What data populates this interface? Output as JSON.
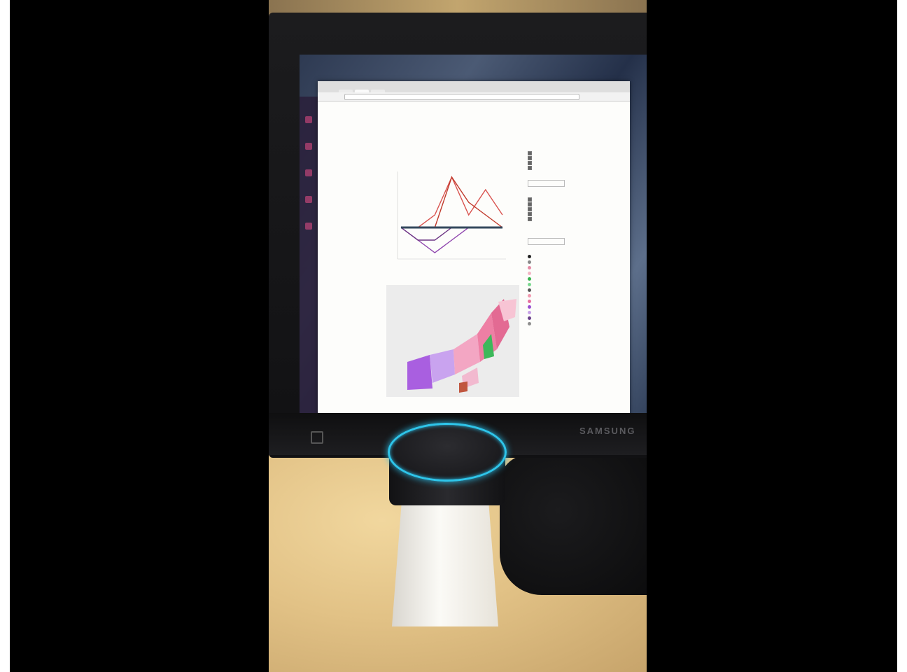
{
  "monitor": {
    "brand": "SAMSUNG"
  },
  "browser": {
    "tabs": [
      "",
      "",
      ""
    ]
  },
  "chart": {
    "title": "",
    "xlabel": ""
  },
  "map": {
    "title": ""
  },
  "sidebar": {
    "legend_colors": [
      "#222",
      "#888",
      "#e58aa5",
      "#f3b4c4",
      "#37b24d",
      "#7bd88f",
      "#555",
      "#f29ab0",
      "#e66fa0",
      "#9a4fd1",
      "#c8a2e8",
      "#6a3f8a",
      "#8e8e8e"
    ]
  },
  "colors": {
    "echo_ring": "#2ec5ea",
    "line_red": "#d9534f",
    "line_purple": "#8e44ad"
  },
  "chart_data": {
    "type": "line",
    "title": "",
    "xlabel": "",
    "ylabel": "",
    "series": [
      {
        "values": [
          0,
          0,
          1,
          4,
          1,
          3,
          1
        ]
      },
      {
        "values": [
          0,
          0,
          0,
          4,
          2,
          1,
          0
        ]
      },
      {
        "values": [
          0,
          -1,
          -2,
          -1,
          0,
          0,
          0
        ]
      },
      {
        "values": [
          0,
          -1,
          -1,
          0,
          0,
          0,
          0
        ]
      },
      {
        "values": [
          0,
          0,
          0,
          0,
          0,
          0,
          0
        ]
      }
    ]
  }
}
